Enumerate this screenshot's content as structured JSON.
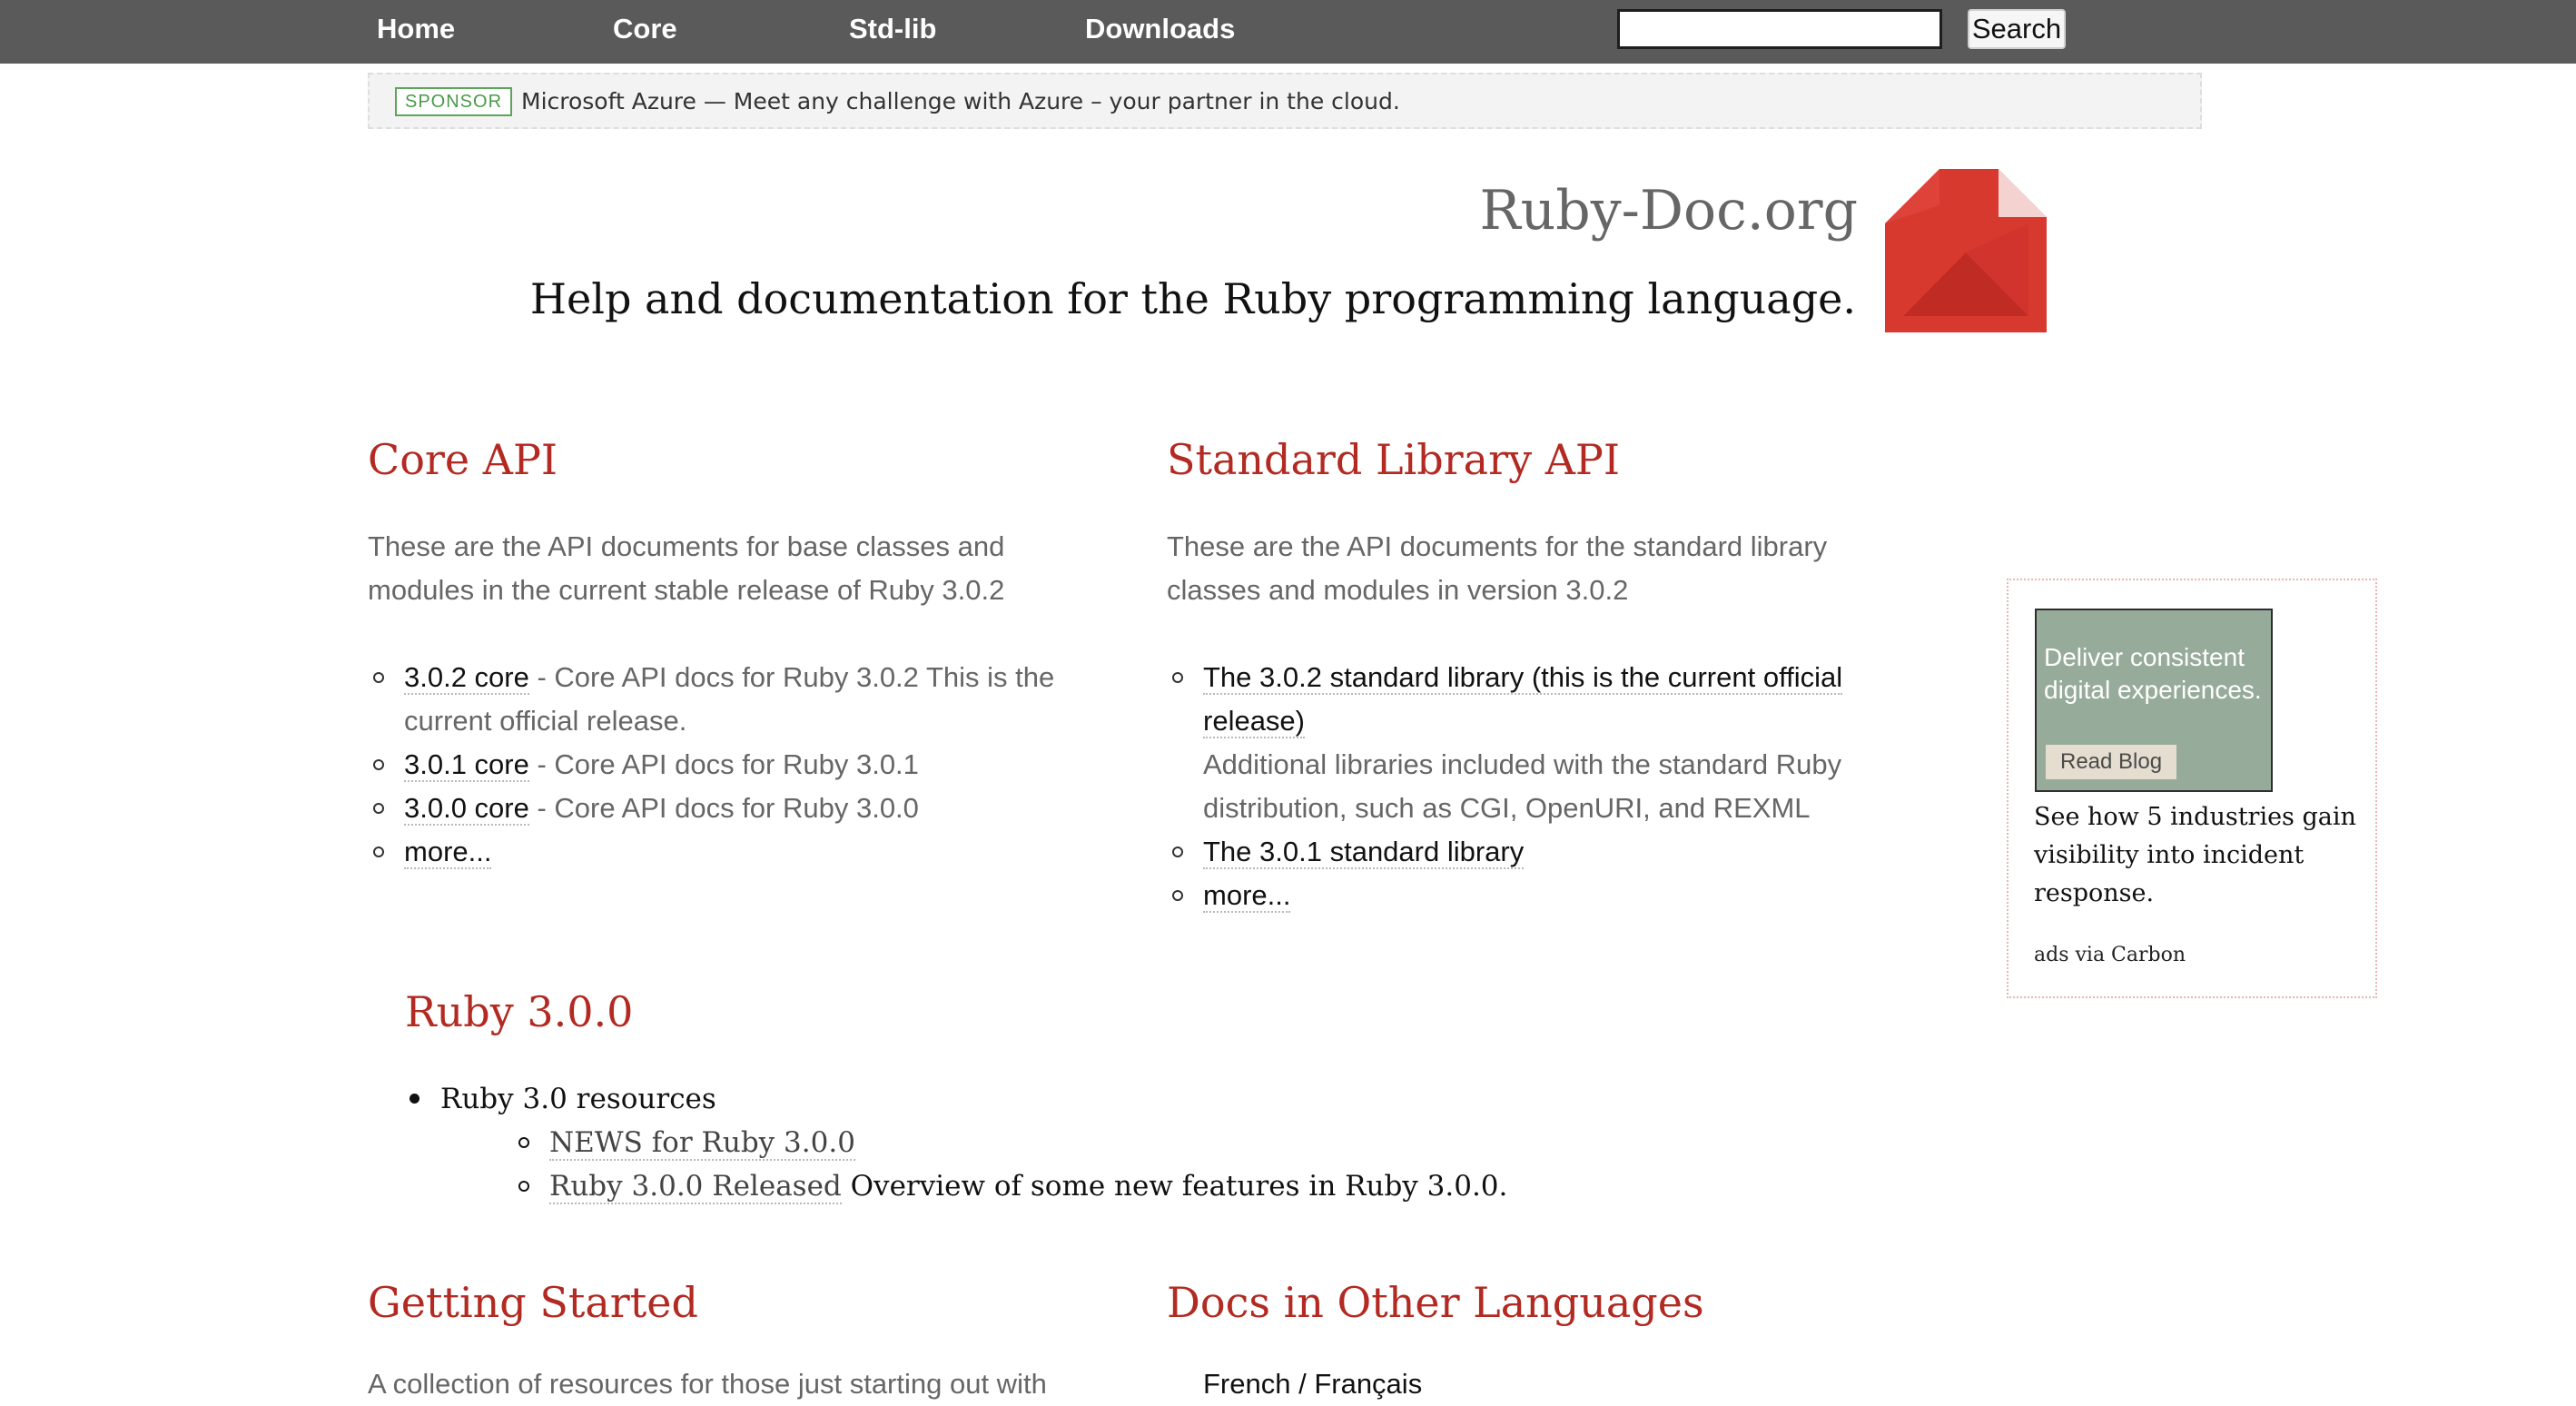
{
  "nav": {
    "home": "Home",
    "core": "Core",
    "stdlib": "Std-lib",
    "downloads": "Downloads",
    "search_value": "",
    "search_button": "Search"
  },
  "sponsor": {
    "badge": "SPONSOR",
    "text": "Microsoft Azure — Meet any challenge with Azure – your partner in the cloud."
  },
  "header": {
    "title": "Ruby-Doc.org",
    "tagline": "Help and documentation for the Ruby programming language."
  },
  "core_api": {
    "title": "Core API",
    "description": "These are the API documents for base classes and modules in the current stable release of Ruby 3.0.2",
    "items": [
      {
        "link": "3.0.2 core",
        "text": " - Core API docs for Ruby 3.0.2 This is the current official release."
      },
      {
        "link": "3.0.1 core",
        "text": " - Core API docs for Ruby 3.0.1"
      },
      {
        "link": "3.0.0 core",
        "text": " - Core API docs for Ruby 3.0.0"
      },
      {
        "link": "more...",
        "text": ""
      }
    ]
  },
  "stdlib_api": {
    "title": "Standard Library API",
    "description": "These are the API documents for the standard library classes and modules in version 3.0.2",
    "items": [
      {
        "link": "The 3.0.2 standard library (this is the current official release)",
        "text": "Additional libraries included with the standard Ruby distribution, such as CGI, OpenURI, and REXML"
      },
      {
        "link": "The 3.0.1 standard library",
        "text": ""
      },
      {
        "link": "more...",
        "text": ""
      }
    ]
  },
  "ruby300": {
    "title": "Ruby 3.0.0",
    "resources_label": "Ruby 3.0 resources",
    "news_link": "NEWS for Ruby 3.0.0",
    "released_link": "Ruby 3.0.0 Released",
    "released_text": " Overview of some new features in Ruby 3.0.0."
  },
  "ad": {
    "image_text": "Deliver consistent digital experiences.",
    "image_button": "Read Blog",
    "caption": "See how 5 industries gain visibility into incident response.",
    "via": "ads via Carbon"
  },
  "getting_started": {
    "title": "Getting Started",
    "intro_cut": "A collection of resources for those just starting out with"
  },
  "other_languages": {
    "title": "Docs in Other Languages",
    "first_item_cut": "French / Français"
  }
}
